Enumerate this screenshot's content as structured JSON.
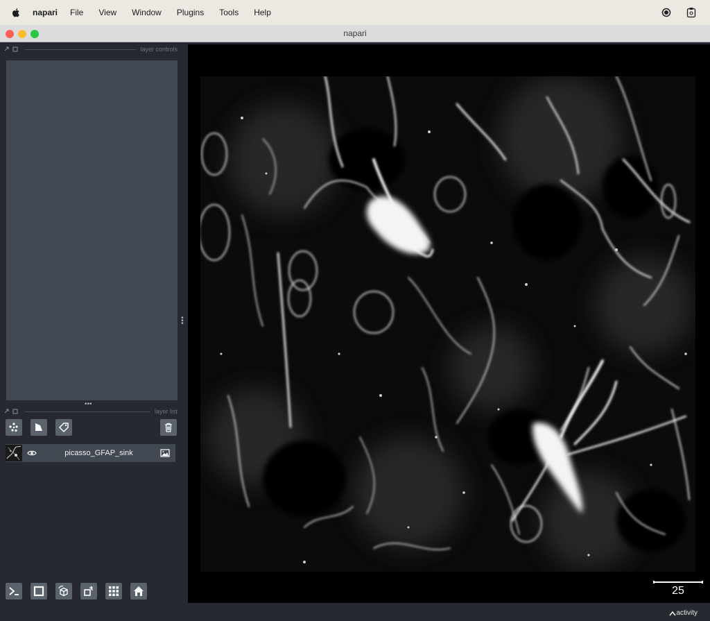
{
  "menubar": {
    "app_name": "napari",
    "items": [
      "File",
      "View",
      "Window",
      "Plugins",
      "Tools",
      "Help"
    ],
    "icons": [
      "apple-icon",
      "record-icon",
      "clipboard-icon"
    ]
  },
  "window": {
    "title": "napari",
    "traffic_colors": [
      "#fe5f57",
      "#febc2e",
      "#28c840"
    ]
  },
  "docks": {
    "layer_controls_title": "layer controls",
    "layer_list_title": "layer list"
  },
  "layer_buttons": [
    "new-points-layer-button",
    "new-shapes-layer-button",
    "new-labels-layer-button",
    "delete-layer-button"
  ],
  "layers": [
    {
      "name": "picasso_GFAP_sink",
      "visible": true,
      "type": "image"
    }
  ],
  "viewer_buttons": [
    "console-button",
    "ndisplay-toggle-button",
    "roll-dims-button",
    "transpose-dims-button",
    "grid-view-button",
    "home-button"
  ],
  "scalebar": {
    "label": "25"
  },
  "status": {
    "activity_label": "activity"
  }
}
